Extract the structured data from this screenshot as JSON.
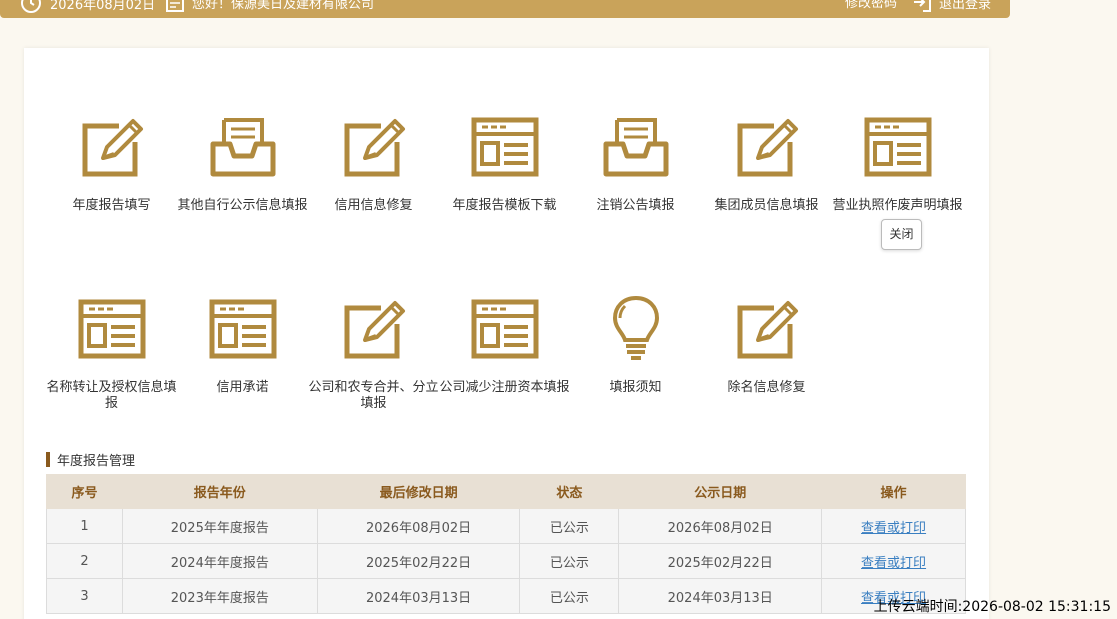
{
  "topbar": {
    "date": "2026年08月02日",
    "greeting": "您好！保源美日及建材有限公司",
    "change_password": "修改密码",
    "logout": "退出登录"
  },
  "tiles": [
    {
      "label": "年度报告填写",
      "icon": "edit-icon"
    },
    {
      "label": "其他自行公示信息填报",
      "icon": "inbox-icon"
    },
    {
      "label": "信用信息修复",
      "icon": "edit-icon"
    },
    {
      "label": "年度报告模板下载",
      "icon": "template-icon"
    },
    {
      "label": "注销公告填报",
      "icon": "inbox-icon"
    },
    {
      "label": "集团成员信息填报",
      "icon": "edit-icon"
    },
    {
      "label": "营业执照作废声明填报",
      "icon": "template-icon"
    },
    {
      "label": "名称转让及授权信息填报",
      "icon": "template-icon"
    },
    {
      "label": "信用承诺",
      "icon": "template-icon"
    },
    {
      "label": "公司和农专合并、分立填报",
      "icon": "edit-icon"
    },
    {
      "label": "公司减少注册资本填报",
      "icon": "template-icon"
    },
    {
      "label": "填报须知",
      "icon": "lightbulb-icon"
    },
    {
      "label": "除名信息修复",
      "icon": "edit-icon"
    }
  ],
  "tooltip": "关闭",
  "annual_reports": {
    "title": "年度报告管理",
    "columns": [
      "序号",
      "报告年份",
      "最后修改日期",
      "状态",
      "公示日期",
      "操作"
    ],
    "rows": [
      [
        "1",
        "2025年年度报告",
        "2026年08月02日",
        "已公示",
        "2026年08月02日",
        "查看或打印"
      ],
      [
        "2",
        "2024年年度报告",
        "2025年02月22日",
        "已公示",
        "2025年02月22日",
        "查看或打印"
      ],
      [
        "3",
        "2023年年度报告",
        "2024年03月13日",
        "已公示",
        "2024年03月13日",
        "查看或打印"
      ]
    ]
  },
  "watermark": "上传云端时间:2026-08-02 15:31:15",
  "colors": {
    "accent": "#b08a3e",
    "topbar": "#c9a35a",
    "header_text": "#8a5a1e",
    "link": "#3a7fc1"
  }
}
